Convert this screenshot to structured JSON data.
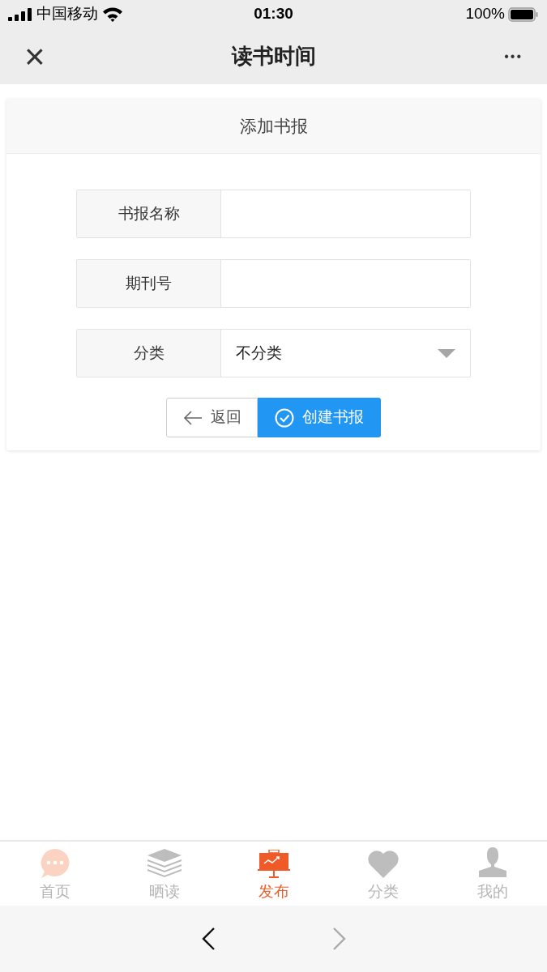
{
  "status_bar": {
    "carrier": "中国移动",
    "time": "01:30",
    "battery": "100%"
  },
  "nav": {
    "close": "×",
    "title": "读书时间",
    "more": "•••"
  },
  "card": {
    "title": "添加书报"
  },
  "form": [
    {
      "kind": "text",
      "label": "书报名称"
    },
    {
      "kind": "text",
      "label": "期刊号"
    },
    {
      "kind": "select",
      "label": "分类",
      "value": "不分类"
    }
  ],
  "buttons": [
    {
      "kind": "back",
      "label": "返回"
    },
    {
      "kind": "primary",
      "label": "创建书报"
    }
  ],
  "tab_bar": [
    {
      "kind": "chat",
      "label": "首页",
      "selected": false
    },
    {
      "kind": "layers",
      "label": "晒读",
      "selected": false
    },
    {
      "kind": "board",
      "label": "发布",
      "selected": true
    },
    {
      "kind": "heart",
      "label": "分类",
      "selected": false
    },
    {
      "kind": "person",
      "label": "我的",
      "selected": false
    }
  ],
  "browser_nav": {
    "back_disabled": false,
    "forward_disabled": true
  }
}
